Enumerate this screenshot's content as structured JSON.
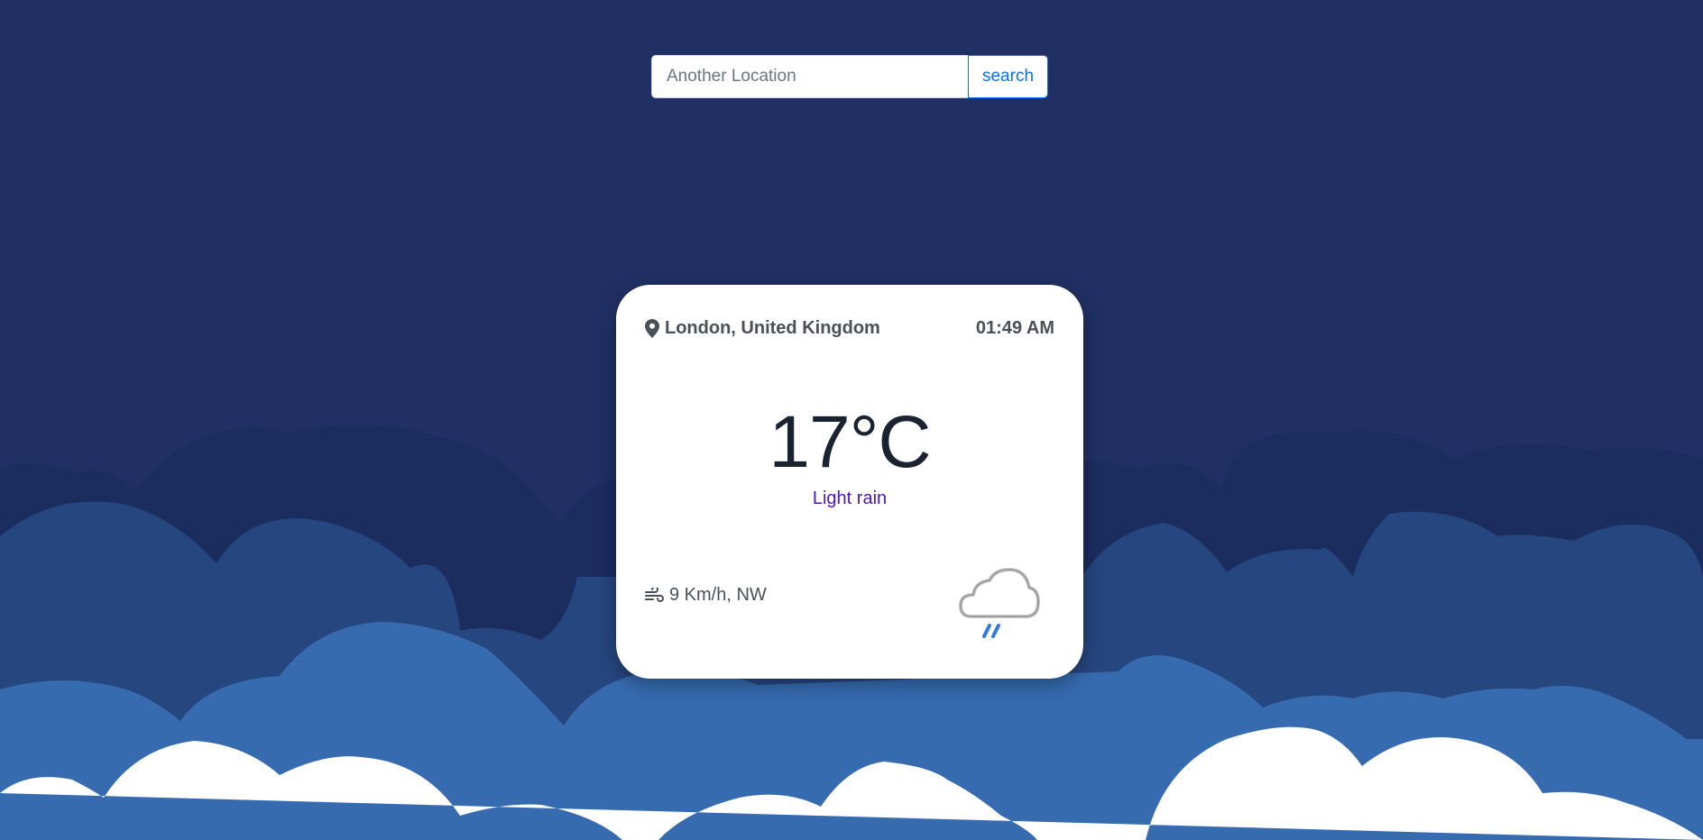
{
  "search": {
    "placeholder": "Another Location",
    "value": "",
    "button_label": "search"
  },
  "card": {
    "location": "London, United Kingdom",
    "time": "01:49 AM",
    "temperature": "17°C",
    "condition": "Light rain",
    "wind": "9 Km/h, NW",
    "location_icon": "map-pin-icon",
    "wind_icon": "wind-icon",
    "weather_icon": "light-rain-cloud-icon"
  },
  "colors": {
    "sky": "#203064",
    "cloud_dark": "#1b2d5f",
    "cloud_mid": "#26467f",
    "cloud_light": "#366bb0",
    "cloud_white": "#ffffff",
    "condition_text": "#4a16b8",
    "accent": "#0d6efd"
  }
}
